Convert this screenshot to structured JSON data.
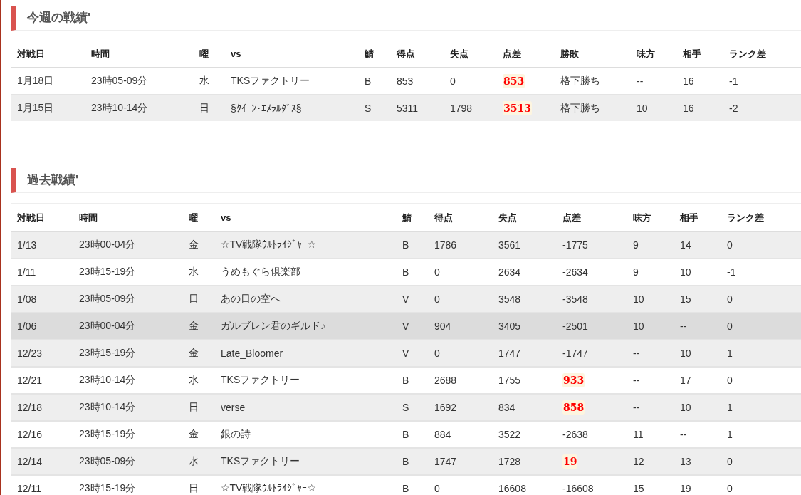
{
  "sections": [
    {
      "title": "今週の戦績'",
      "columns": [
        "対戦日",
        "時間",
        "曜",
        "vs",
        "鯖",
        "得点",
        "失点",
        "点差",
        "勝敗",
        "味方",
        "相手",
        "ランク差"
      ],
      "rows": [
        {
          "cells": [
            "1月18日",
            "23時05-09分",
            "水",
            "TKSファクトリー",
            "B",
            "853",
            "0",
            "853",
            "格下勝ち",
            "--",
            "16",
            "-1"
          ],
          "win": true,
          "highlighted": false
        },
        {
          "cells": [
            "1月15日",
            "23時10-14分",
            "日",
            "§ｸｲｰﾝ･ｴﾒﾗﾙﾀﾞｽ§",
            "S",
            "5311",
            "1798",
            "3513",
            "格下勝ち",
            "10",
            "16",
            "-2"
          ],
          "win": true,
          "highlighted": false
        }
      ]
    },
    {
      "title": "過去戦績'",
      "columns": [
        "対戦日",
        "時間",
        "曜",
        "vs",
        "鯖",
        "得点",
        "失点",
        "点差",
        "味方",
        "相手",
        "ランク差"
      ],
      "rows": [
        {
          "cells": [
            "1/13",
            "23時00-04分",
            "金",
            "☆TV戦隊ｳﾙﾄﾗｲｼﾞｬｰ☆",
            "B",
            "1786",
            "3561",
            "-1775",
            "9",
            "14",
            "0"
          ],
          "win": false,
          "highlighted": false
        },
        {
          "cells": [
            "1/11",
            "23時15-19分",
            "水",
            "うめもぐら倶楽部",
            "B",
            "0",
            "2634",
            "-2634",
            "9",
            "10",
            "-1"
          ],
          "win": false,
          "highlighted": false
        },
        {
          "cells": [
            "1/08",
            "23時05-09分",
            "日",
            "あの日の空へ",
            "V",
            "0",
            "3548",
            "-3548",
            "10",
            "15",
            "0"
          ],
          "win": false,
          "highlighted": false
        },
        {
          "cells": [
            "1/06",
            "23時00-04分",
            "金",
            "ガルブレン君のギルド♪",
            "V",
            "904",
            "3405",
            "-2501",
            "10",
            "--",
            "0"
          ],
          "win": false,
          "highlighted": true
        },
        {
          "cells": [
            "12/23",
            "23時15-19分",
            "金",
            "Late_Bloomer",
            "V",
            "0",
            "1747",
            "-1747",
            "--",
            "10",
            "1"
          ],
          "win": false,
          "highlighted": false
        },
        {
          "cells": [
            "12/21",
            "23時10-14分",
            "水",
            "TKSファクトリー",
            "B",
            "2688",
            "1755",
            "933",
            "--",
            "17",
            "0"
          ],
          "win": true,
          "highlighted": false
        },
        {
          "cells": [
            "12/18",
            "23時10-14分",
            "日",
            "verse",
            "S",
            "1692",
            "834",
            "858",
            "--",
            "10",
            "1"
          ],
          "win": true,
          "highlighted": false
        },
        {
          "cells": [
            "12/16",
            "23時15-19分",
            "金",
            "銀の詩",
            "B",
            "884",
            "3522",
            "-2638",
            "11",
            "--",
            "1"
          ],
          "win": false,
          "highlighted": false
        },
        {
          "cells": [
            "12/14",
            "23時05-09分",
            "水",
            "TKSファクトリー",
            "B",
            "1747",
            "1728",
            "19",
            "12",
            "13",
            "0"
          ],
          "win": true,
          "highlighted": false
        },
        {
          "cells": [
            "12/11",
            "23時15-19分",
            "日",
            "☆TV戦隊ｳﾙﾄﾗｲｼﾞｬｰ☆",
            "B",
            "0",
            "16608",
            "-16608",
            "15",
            "19",
            "0"
          ],
          "win": false,
          "highlighted": false
        }
      ]
    }
  ]
}
